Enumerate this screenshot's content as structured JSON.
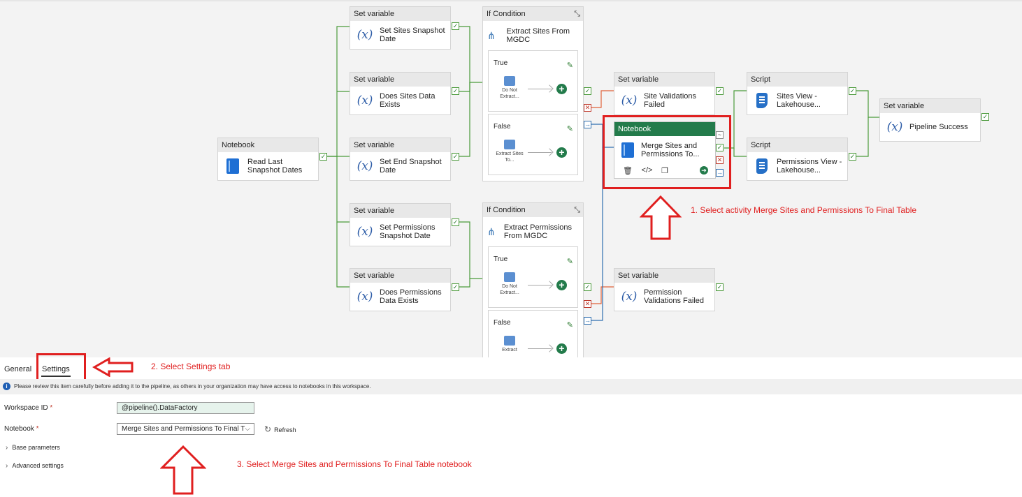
{
  "pipeline": {
    "notebook_read": {
      "type": "Notebook",
      "label": "Read Last Snapshot Dates"
    },
    "set_vars": [
      {
        "type": "Set variable",
        "label": "Set Sites Snapshot Date"
      },
      {
        "type": "Set variable",
        "label": "Does Sites Data Exists"
      },
      {
        "type": "Set variable",
        "label": "Set End Snapshot Date"
      },
      {
        "type": "Set variable",
        "label": "Set Permissions Snapshot Date"
      },
      {
        "type": "Set variable",
        "label": "Does Permissions Data Exists"
      }
    ],
    "if_sites": {
      "type": "If Condition",
      "label": "Extract Sites From MGDC",
      "true_branch": {
        "title": "True",
        "activity": "Do Not Extract..."
      },
      "false_branch": {
        "title": "False",
        "activity": "Extract Sites To..."
      }
    },
    "if_perms": {
      "type": "If Condition",
      "label": "Extract Permissions From MGDC",
      "true_branch": {
        "title": "True",
        "activity": "Do Not Extract..."
      },
      "false_branch": {
        "title": "False",
        "activity": "Extract"
      }
    },
    "site_val_failed": {
      "type": "Set variable",
      "label": "Site Validations Failed"
    },
    "perm_val_failed": {
      "type": "Set variable",
      "label": "Permission Validations Failed"
    },
    "merge_notebook": {
      "type": "Notebook",
      "label": "Merge Sites and Permissions To..."
    },
    "script_sites": {
      "type": "Script",
      "label": "Sites View - Lakehouse..."
    },
    "script_perms": {
      "type": "Script",
      "label": "Permissions View - Lakehouse..."
    },
    "pipeline_success": {
      "type": "Set variable",
      "label": "Pipeline Success"
    }
  },
  "annotations": {
    "step1": "1. Select activity Merge Sites and Permissions To Final Table",
    "step2": "2. Select Settings tab",
    "step3": "3. Select Merge Sites and Permissions To Final Table notebook"
  },
  "panel": {
    "tabs": [
      "General",
      "Settings"
    ],
    "active_tab": "Settings",
    "info": "Please review this item carefully before adding it to the pipeline, as others in your organization may have access to notebooks in this workspace.",
    "workspace_label": "Workspace ID",
    "workspace_value": "@pipeline().DataFactory",
    "notebook_label": "Notebook",
    "notebook_value": "Merge Sites and Permissions To Final T",
    "refresh": "Refresh",
    "base_params": "Base parameters",
    "advanced": "Advanced settings"
  },
  "colors": {
    "accent_green": "#237b4b",
    "annotation_red": "#e01f1f",
    "success_wire": "#4a9a3a",
    "fail_wire": "#e0623a",
    "skip_wire": "#2f6fb0"
  }
}
